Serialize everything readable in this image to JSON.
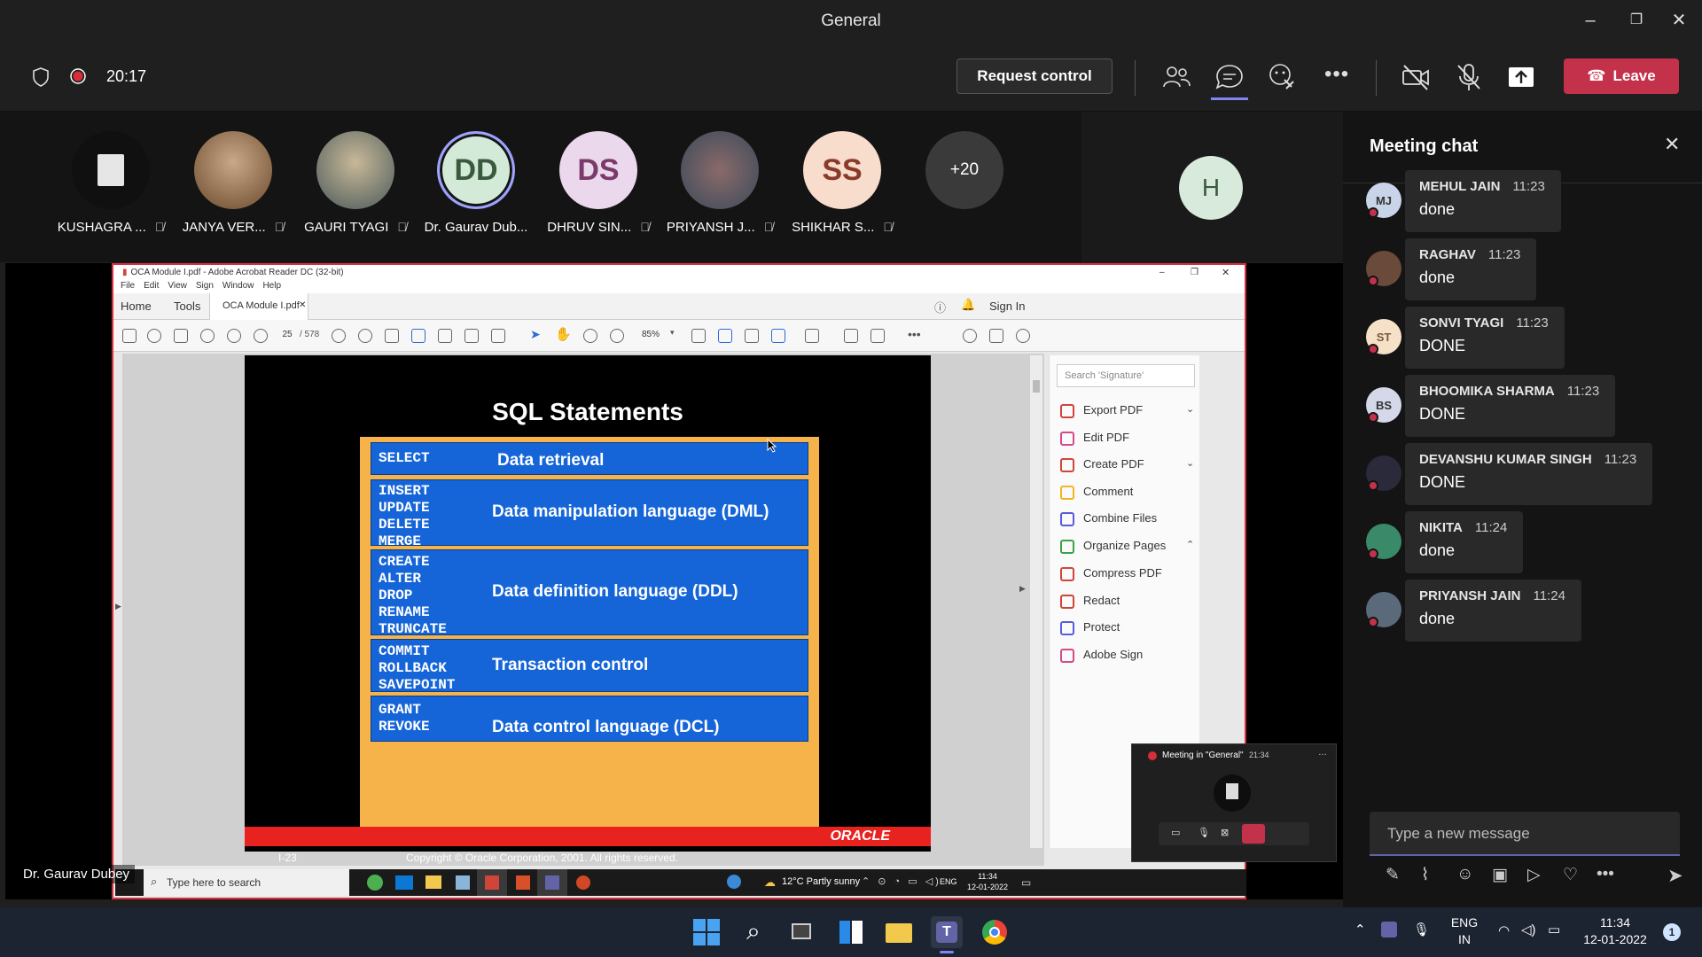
{
  "window": {
    "title": "General"
  },
  "controls": {
    "timer": "20:17",
    "request_control": "Request control",
    "leave": "Leave"
  },
  "participants": [
    {
      "name": "KUSHAGRA ...",
      "initials": "",
      "color": "#1a1a1a"
    },
    {
      "name": "JANYA VER...",
      "initials": "",
      "color": "#8a6a4a"
    },
    {
      "name": "GAURI TYAGI",
      "initials": "",
      "color": "#6a6a4a"
    },
    {
      "name": "Dr. Gaurav Dub...",
      "initials": "DD",
      "color": "#d4ead8"
    },
    {
      "name": "DHRUV SIN...",
      "initials": "DS",
      "color": "#e8d4e8"
    },
    {
      "name": "PRIYANSH J...",
      "initials": "",
      "color": "#4a5a6a"
    },
    {
      "name": "SHIKHAR S...",
      "initials": "SS",
      "color": "#f5d8c8"
    },
    {
      "name": "",
      "initials": "+20",
      "color": "#3a3a3a"
    }
  ],
  "extra_participant": {
    "initials": "H"
  },
  "acrobat": {
    "title": "OCA Module I.pdf - Adobe Acrobat Reader DC (32-bit)",
    "menu": [
      "File",
      "Edit",
      "View",
      "Sign",
      "Window",
      "Help"
    ],
    "tabs": {
      "home": "Home",
      "tools": "Tools",
      "doc": "OCA Module I.pdf",
      "sign_in": "Sign In"
    },
    "page_current": "25",
    "page_total": "/ 578",
    "zoom": "85%",
    "search_placeholder": "Search 'Signature'",
    "tools_list": [
      {
        "label": "Export PDF",
        "color": "#d0453a",
        "chev": "⌄"
      },
      {
        "label": "Edit PDF",
        "color": "#d44a8a",
        "chev": ""
      },
      {
        "label": "Create PDF",
        "color": "#d0453a",
        "chev": "⌄"
      },
      {
        "label": "Comment",
        "color": "#f2b324",
        "chev": ""
      },
      {
        "label": "Combine Files",
        "color": "#5a5ae0",
        "chev": ""
      },
      {
        "label": "Organize Pages",
        "color": "#3aa34a",
        "chev": "⌃"
      },
      {
        "label": "Compress PDF",
        "color": "#d0453a",
        "chev": ""
      },
      {
        "label": "Redact",
        "color": "#d0453a",
        "chev": ""
      },
      {
        "label": "Protect",
        "color": "#5a5ae0",
        "chev": ""
      },
      {
        "label": "Adobe Sign",
        "color": "#d44a8a",
        "chev": ""
      }
    ]
  },
  "slide": {
    "title": "SQL Statements",
    "rows": [
      {
        "keywords": [
          "SELECT"
        ],
        "desc": "Data retrieval"
      },
      {
        "keywords": [
          "INSERT",
          "UPDATE",
          "DELETE",
          "MERGE"
        ],
        "desc": "Data manipulation language (DML)"
      },
      {
        "keywords": [
          "CREATE",
          "ALTER",
          "DROP",
          "RENAME",
          "TRUNCATE"
        ],
        "desc": "Data definition language (DDL)"
      },
      {
        "keywords": [
          "COMMIT",
          "ROLLBACK",
          "SAVEPOINT"
        ],
        "desc": "Transaction control"
      },
      {
        "keywords": [
          "GRANT",
          "REVOKE"
        ],
        "desc": "Data control language (DCL)"
      }
    ],
    "brand": "ORACLE",
    "page_label": "I-23",
    "copyright": "Copyright © Oracle Corporation, 2001. All rights reserved."
  },
  "shared_taskbar": {
    "search": "Type here to search",
    "weather": "12°C  Partly sunny",
    "lang": "ENG",
    "time": "11:34",
    "date": "12-01-2022"
  },
  "mini_meeting": {
    "title": "Meeting in \"General\"",
    "time": "21:34"
  },
  "presenter_label": "Dr. Gaurav Dubey",
  "chat": {
    "title": "Meeting chat",
    "messages": [
      {
        "name": "MEHUL JAIN",
        "time": "11:23",
        "text": "done",
        "initials": "MJ",
        "color": "#c8d4e8",
        "fg": "#333"
      },
      {
        "name": "RAGHAV",
        "time": "11:23",
        "text": "done",
        "initials": "",
        "color": "#6a4a3a",
        "fg": "#fff"
      },
      {
        "name": "SONVI TYAGI",
        "time": "11:23",
        "text": "DONE",
        "initials": "ST",
        "color": "#f5e0c8",
        "fg": "#7a5a3a"
      },
      {
        "name": "BHOOMIKA SHARMA",
        "time": "11:23",
        "text": "DONE",
        "initials": "BS",
        "color": "#d4d8e8",
        "fg": "#333"
      },
      {
        "name": "DEVANSHU KUMAR SINGH",
        "time": "11:23",
        "text": "DONE",
        "initials": "",
        "color": "#2a2a3a",
        "fg": "#fff"
      },
      {
        "name": "NIKITA",
        "time": "11:24",
        "text": "done",
        "initials": "",
        "color": "#3a8a6a",
        "fg": "#fff"
      },
      {
        "name": "PRIYANSH JAIN",
        "time": "11:24",
        "text": "done",
        "initials": "",
        "color": "#5a6a7a",
        "fg": "#fff"
      }
    ],
    "compose_placeholder": "Type a new message"
  },
  "taskbar": {
    "lang_top": "ENG",
    "lang_bottom": "IN",
    "time": "11:34",
    "date": "12-01-2022",
    "notifications": "1"
  }
}
